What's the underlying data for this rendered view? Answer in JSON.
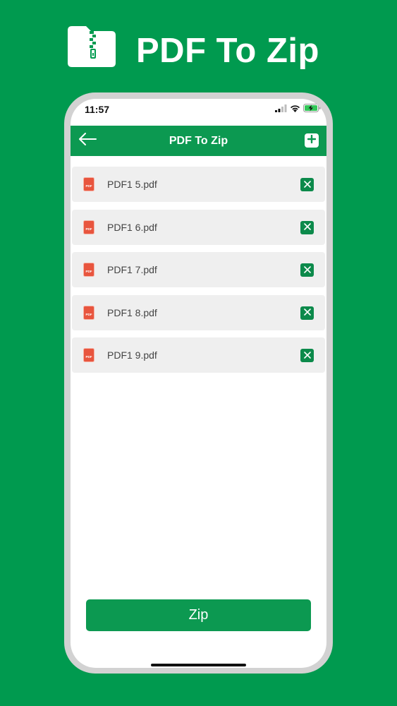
{
  "promo": {
    "title": "PDF To Zip",
    "logo_icon": "zip-folder-icon"
  },
  "status_bar": {
    "time": "11:57",
    "icons": [
      "signal-icon",
      "wifi-icon",
      "battery-charging-icon"
    ]
  },
  "app_bar": {
    "title": "PDF To Zip",
    "back_icon": "arrow-left-icon",
    "add_icon": "plus-icon"
  },
  "files": [
    {
      "name": "PDF1 5.pdf",
      "icon_label": "PDF"
    },
    {
      "name": "PDF1 6.pdf",
      "icon_label": "PDF"
    },
    {
      "name": "PDF1 7.pdf",
      "icon_label": "PDF"
    },
    {
      "name": "PDF1 8.pdf",
      "icon_label": "PDF"
    },
    {
      "name": "PDF1 9.pdf",
      "icon_label": "PDF"
    }
  ],
  "zip_button": {
    "label": "Zip"
  },
  "colors": {
    "background": "#009a4f",
    "app_bar": "#0c9951",
    "remove_button": "#0c8a4b",
    "list_item": "#efefef",
    "pdf_icon": "#e8553e"
  }
}
